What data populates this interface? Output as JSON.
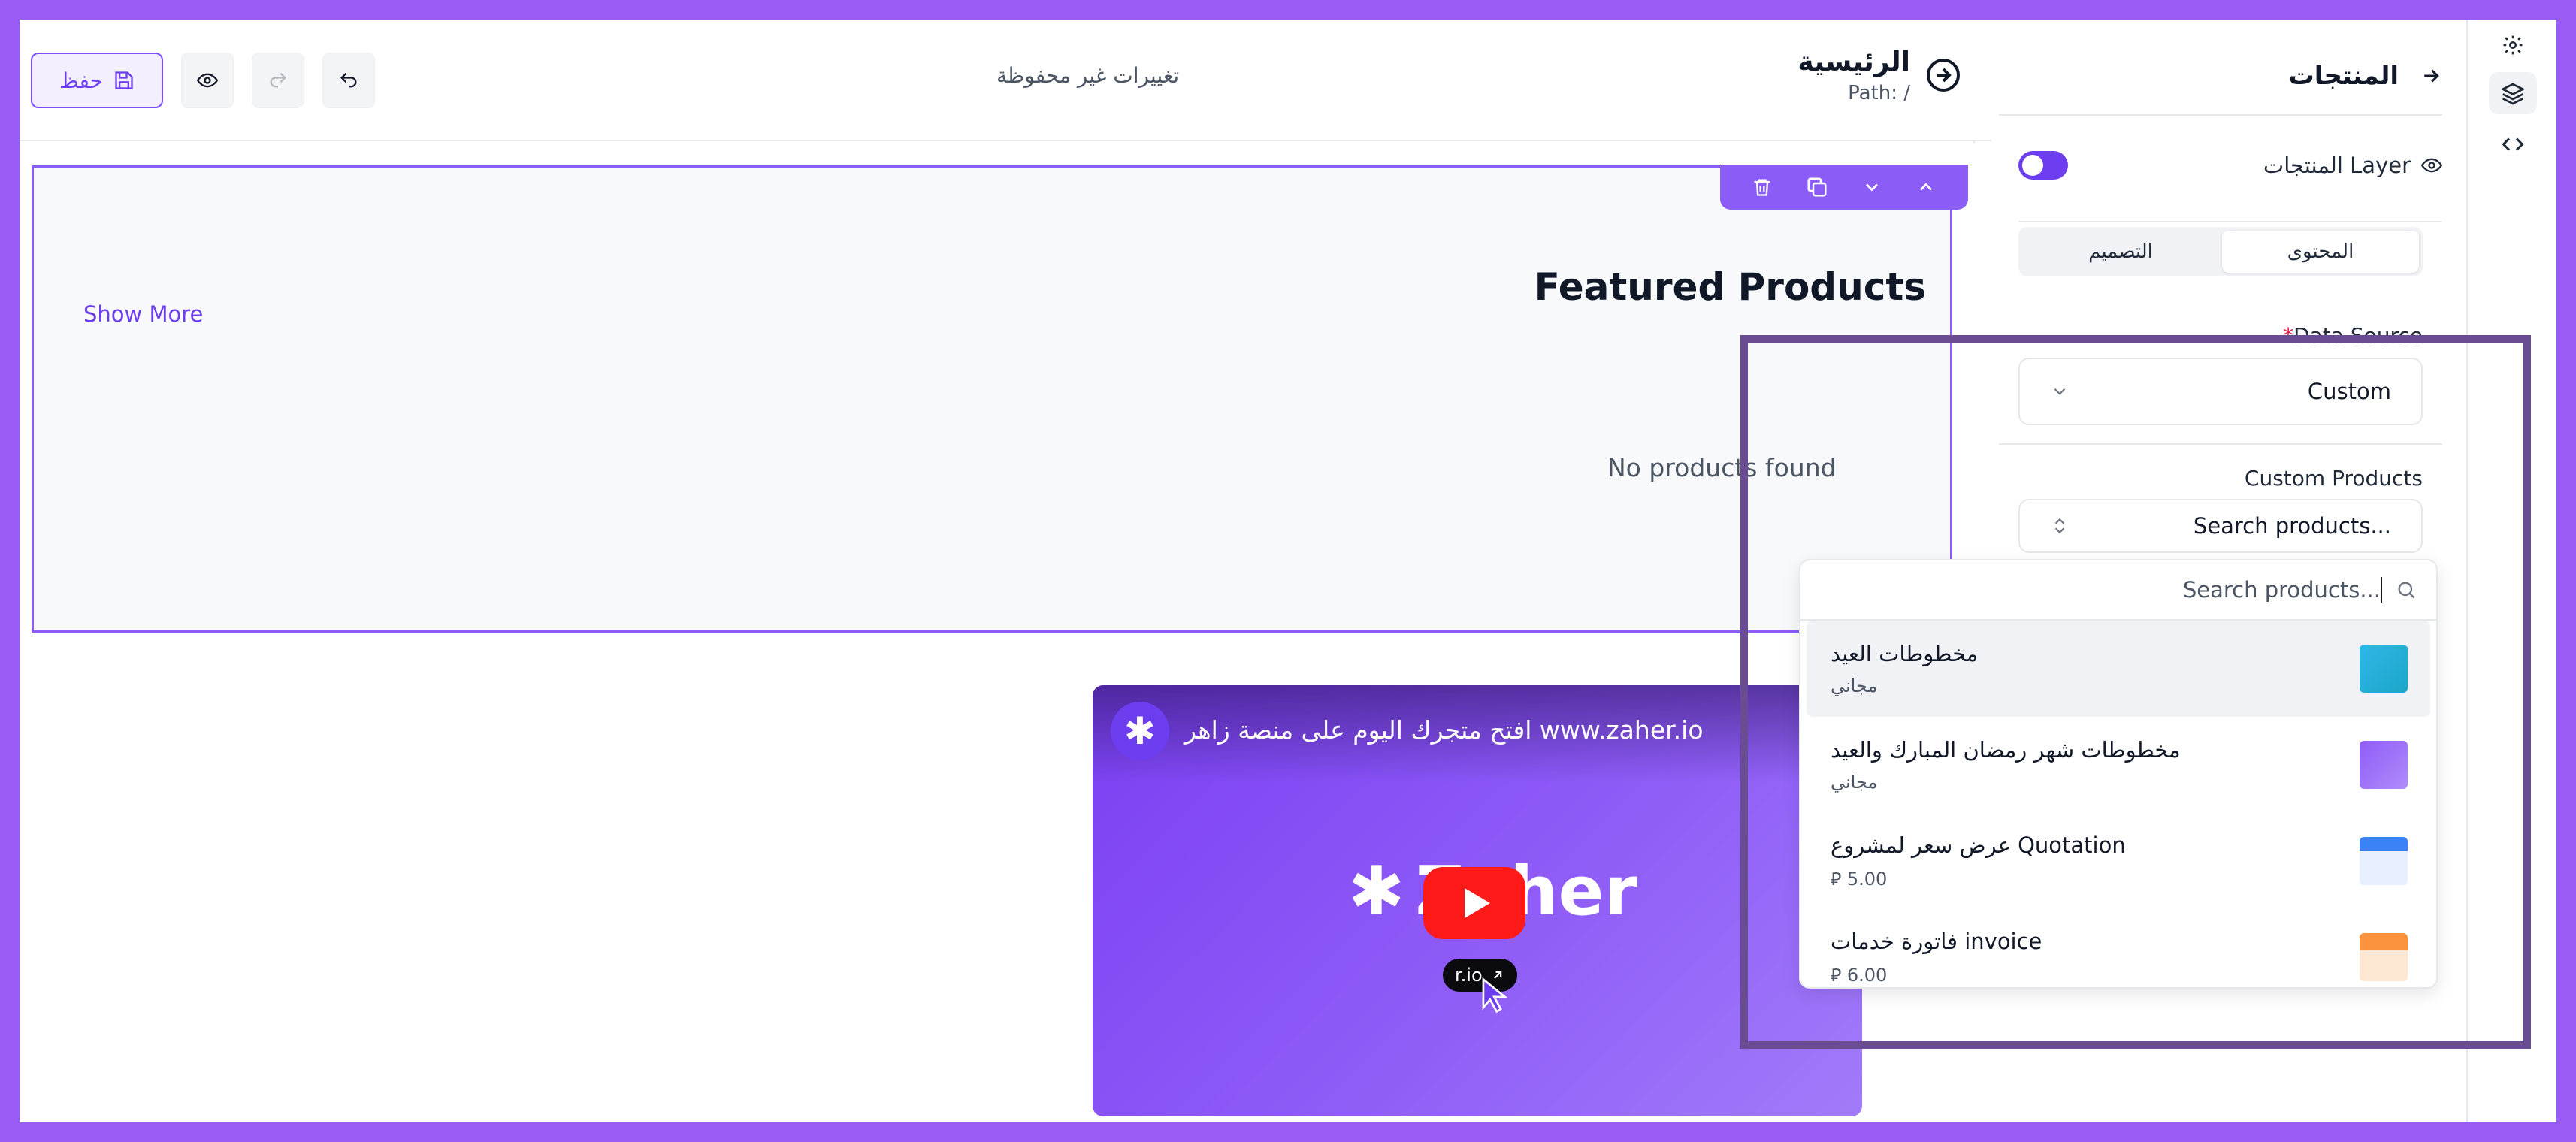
{
  "topbar": {
    "save_label": "حفظ",
    "unsaved_text": "تغييرات غير محفوظة",
    "page_title": "الرئيسية",
    "page_path": "Path: /"
  },
  "section": {
    "title": "Featured Products",
    "show_more": "Show More",
    "empty_text": "No products found"
  },
  "video": {
    "title": "افتح متجرك اليوم على منصة زاهر www.zaher.io",
    "logo_text": "Zaher",
    "chip_text": "r.io"
  },
  "panel": {
    "title": "المنتجات",
    "layer_label": "المنتجات Layer",
    "tabs": [
      {
        "label": "المحتوى",
        "active": true
      },
      {
        "label": "التصميم",
        "active": false
      }
    ],
    "data_source_label": "Data Source",
    "required_mark": "*",
    "data_source_value": "Custom",
    "custom_products_label": "Custom Products",
    "search_select_text": "Search products..."
  },
  "dropdown": {
    "search_placeholder": "Search products...",
    "items": [
      {
        "name": "مخطوطات العيد",
        "price": "مجاني"
      },
      {
        "name": "مخطوطات شهر رمضان المبارك والعيد",
        "price": "مجاني"
      },
      {
        "name": "عرض سعر لمشروع Quotation",
        "price": "5.00"
      },
      {
        "name": "فاتورة خدمات invoice",
        "price": "6.00"
      }
    ]
  },
  "colors": {
    "accent": "#6d3df0",
    "frame": "#9b5cf6",
    "highlight": "#6a4c93"
  },
  "icons": [
    "gear-icon",
    "layers-icon",
    "code-icon",
    "arrow-right-icon",
    "eye-icon",
    "save-icon",
    "undo-icon",
    "redo-icon",
    "trash-icon",
    "copy-icon",
    "chevron-down-icon",
    "chevron-up-icon",
    "search-icon",
    "chevrons-updown-icon",
    "play-icon"
  ]
}
